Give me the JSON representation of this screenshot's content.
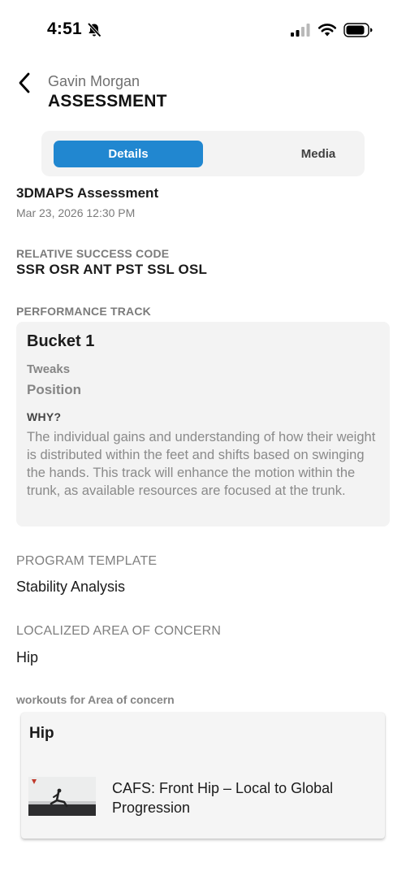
{
  "status_bar": {
    "time": "4:51",
    "icons": [
      "bell-slash-icon",
      "signal-icon",
      "wifi-icon",
      "battery-icon"
    ]
  },
  "header": {
    "subtitle": "Gavin Morgan",
    "title": "ASSESSMENT",
    "back_icon": "chevron-left-icon"
  },
  "tabs": [
    {
      "label": "Details",
      "selected": true
    },
    {
      "label": "Media",
      "selected": false
    }
  ],
  "assessment": {
    "name": "3DMAPS Assessment",
    "date": "Mar 23, 2026 12:30 PM"
  },
  "relative_success_code": {
    "label": "RELATIVE SUCCESS CODE",
    "value": "SSR OSR ANT PST SSL OSL"
  },
  "performance_track": {
    "label": "PERFORMANCE TRACK",
    "bucket": "Bucket 1",
    "tweaks_label": "Tweaks",
    "position_label": "Position",
    "why_label": "WHY?",
    "why_text": "The individual gains and understanding of how their weight is distributed within the feet and shifts based on swinging the hands. This track will enhance the motion within the trunk, as available resources are focused at the trunk."
  },
  "program_template": {
    "label": "PROGRAM TEMPLATE",
    "value": "Stability Analysis"
  },
  "localized_area": {
    "label": "LOCALIZED AREA OF CONCERN",
    "value": "Hip"
  },
  "workouts": {
    "label": "workouts for Area of concern",
    "card_title": "Hip",
    "items": [
      {
        "name": "CAFS: Front Hip – Local to Global Progression"
      }
    ]
  },
  "colors": {
    "accent": "#2187d0",
    "card_bg": "#f3f3f3",
    "muted_text": "#7b7b7b"
  }
}
